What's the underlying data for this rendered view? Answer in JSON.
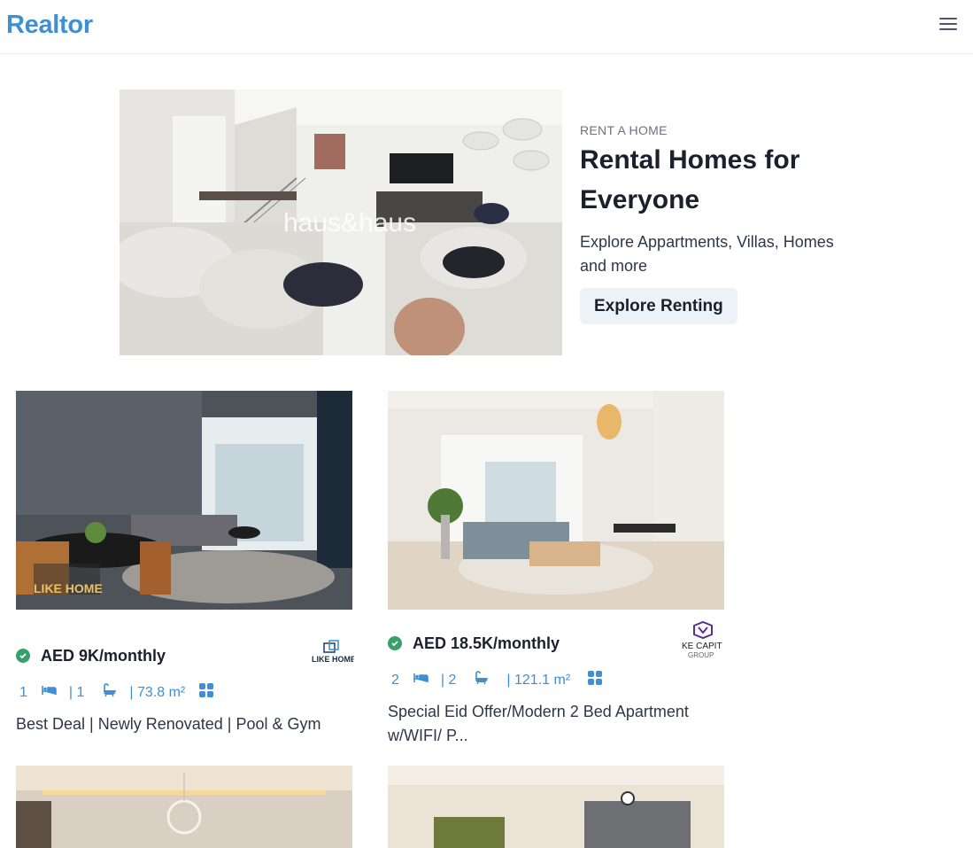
{
  "header": {
    "brand": "Realtor",
    "menu_icon": "hamburger-menu-icon"
  },
  "hero": {
    "image_alt": "Living room interior",
    "watermark": "haus&haus",
    "eyebrow": "RENT A HOME",
    "title": "Rental Homes for Everyone",
    "description": "Explore Appartments, Villas, Homes and more",
    "button_label": "Explore Renting"
  },
  "listings": [
    {
      "price": "AED 9K/monthly",
      "verified_icon": "check-circle-icon",
      "agency_logo_text": "LIKE HOME",
      "image_watermark": "LIKE HOME",
      "rooms": "1",
      "baths": "| 1",
      "area": "| 73.8 m²",
      "title": "Best Deal | Newly Renovated | Pool & Gym",
      "icons": [
        "bed-icon",
        "bath-icon",
        "grid-icon"
      ]
    },
    {
      "price": "AED 18.5K/monthly",
      "verified_icon": "check-circle-icon",
      "agency_logo_text": "KE CAPIT",
      "agency_logo_sub": "GROUP",
      "rooms": "2",
      "baths": "| 2",
      "area": "| 121.1 m²",
      "title": "Special Eid Offer/Modern 2 Bed Apartment w/WIFI/ P...",
      "icons": [
        "bed-icon",
        "bath-icon",
        "grid-icon"
      ]
    }
  ],
  "colors": {
    "brand": "#3f8fd2",
    "verified": "#38a169",
    "button_bg": "#edf2f7",
    "spec_text": "#3f8fd2"
  }
}
